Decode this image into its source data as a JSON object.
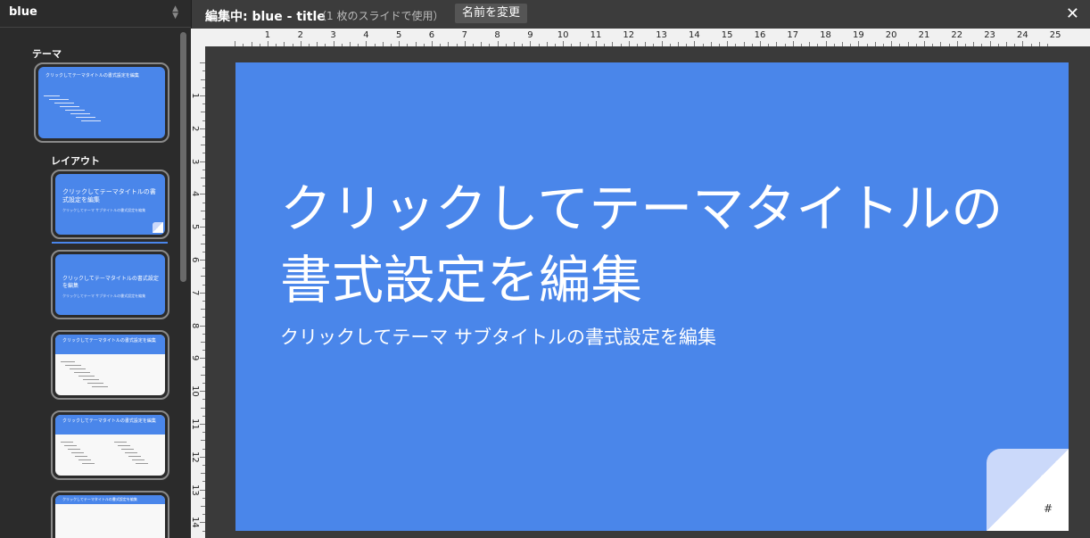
{
  "sidebar": {
    "theme_name": "blue",
    "theme_label": "テーマ",
    "layout_label": "レイアウト",
    "thumb_title": "クリックしてテーマタイトルの書式設定を編集",
    "thumb_sub": "クリックしてテーマ サブタイトルの書式設定を編集"
  },
  "topbar": {
    "editing_title": "編集中: blue - title",
    "usage": "（1 枚のスライドで使用）",
    "rename_label": "名前を変更",
    "close_glyph": "✕"
  },
  "slide": {
    "title": "クリックしてテーマタイトルの書式設定を編集",
    "subtitle": "クリックしてテーマ サブタイトルの書式設定を編集",
    "page_number": "#"
  },
  "ruler": {
    "h_numbers": [
      "1",
      "2",
      "3",
      "4",
      "5",
      "6",
      "7",
      "8",
      "9",
      "10",
      "11",
      "12",
      "13",
      "14",
      "15",
      "16",
      "17",
      "18",
      "19",
      "20",
      "21",
      "22",
      "23",
      "24",
      "25"
    ],
    "v_numbers": [
      "1",
      "2",
      "3",
      "4",
      "5",
      "6",
      "7",
      "8",
      "9",
      "10",
      "11",
      "12",
      "13",
      "14"
    ]
  },
  "colors": {
    "accent": "#4a86ea",
    "panel": "#2b2b2b",
    "corner": "#cbd9fa"
  }
}
